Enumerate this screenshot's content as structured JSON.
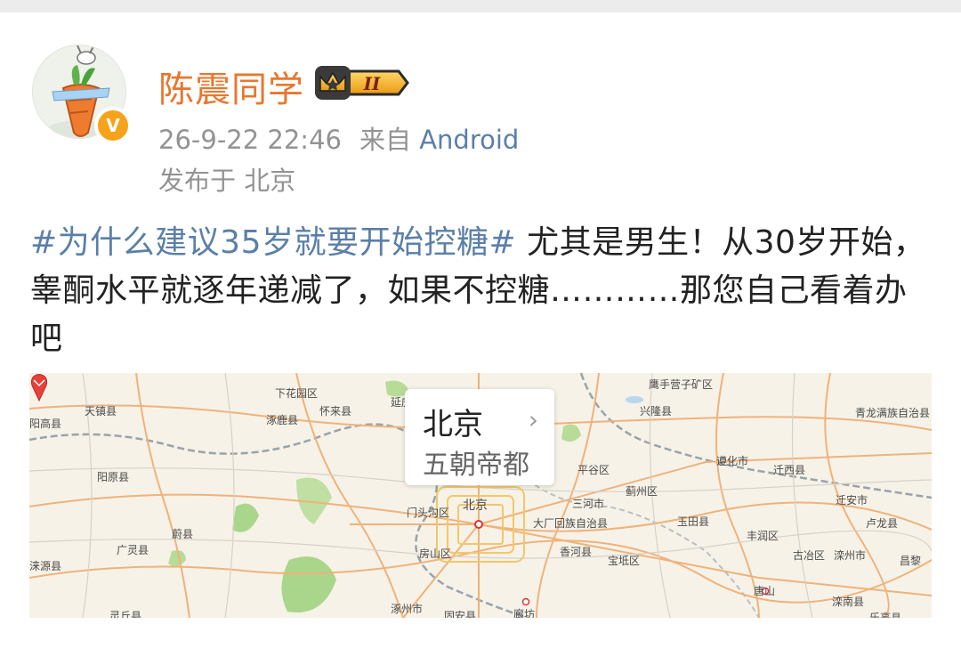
{
  "post": {
    "author": {
      "name": "陈震同学",
      "vip_level": "II",
      "verified_mark": "V"
    },
    "meta": {
      "timestamp": "26-9-22 22:46",
      "source_prefix": "来自",
      "source": "Android",
      "location": "发布于 北京"
    },
    "content": {
      "hashtag": "#为什么建议35岁就要开始控糖#",
      "text": " 尤其是男生！从30岁开始，睾酮水平就逐年递减了，如果不控糖…………那您自己看着办吧"
    },
    "map": {
      "popup_title": "北京",
      "popup_subtitle": "五朝帝都",
      "labels": [
        "阳高县",
        "天镇县",
        "下花园区",
        "怀来县",
        "涿鹿县",
        "延庆",
        "鹰手营子矿区",
        "兴隆县",
        "青龙满族自治县",
        "阳原县",
        "平谷区",
        "遵化市",
        "迁西县",
        "蔚县",
        "北京",
        "门头沟区",
        "三河市",
        "蓟州区",
        "迁安市",
        "大厂回族自治县",
        "玉田县",
        "卢龙县",
        "广灵县",
        "房山区",
        "香河县",
        "宝坻区",
        "丰润区",
        "古冶区",
        "滦州市",
        "昌黎",
        "涞源县",
        "涿州市",
        "固安县",
        "廊坊",
        "唐山",
        "滦南县",
        "乐亭县",
        "灵丘县"
      ]
    }
  },
  "colors": {
    "username": "#e8772e",
    "link": "#5b7fa8",
    "meta": "#939393",
    "body_text": "#222222",
    "vip_gold": "#f2b01e"
  },
  "icons": {
    "avatar": "cartoon-carrot-avatar",
    "verified": "verified-v-badge",
    "vip": "crown-vip-badge",
    "popup_more": "chevron-right-icon",
    "location_pin": "map-pin-icon"
  }
}
